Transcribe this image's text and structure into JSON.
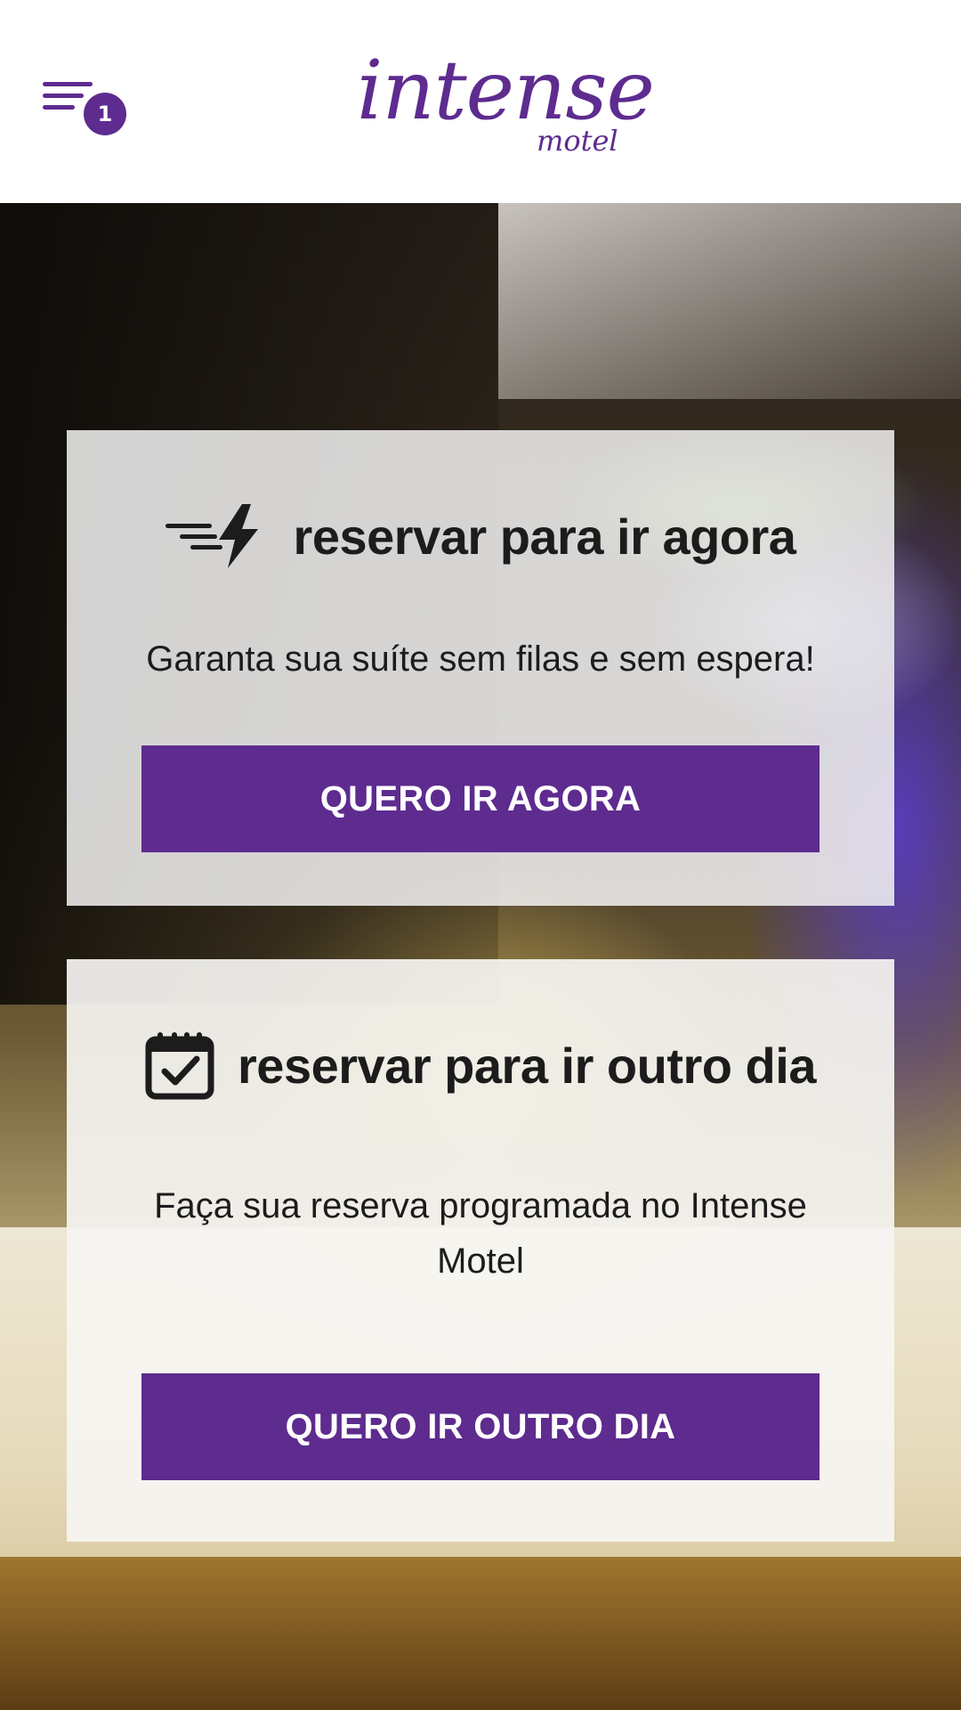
{
  "header": {
    "menu_badge_count": "1",
    "logo_main": "intense",
    "logo_sub": "motel"
  },
  "cards": [
    {
      "title": "reservar para ir agora",
      "description": "Garanta sua suíte sem filas e sem espera!",
      "button_label": "QUERO IR AGORA",
      "icon": "fast-lightning-icon"
    },
    {
      "title": "reservar para ir outro dia",
      "description": "Faça sua reserva programada no Intense Motel",
      "button_label": "QUERO IR OUTRO DIA",
      "icon": "calendar-check-icon"
    }
  ],
  "colors": {
    "brand": "#5e2b8f",
    "text": "#1c1c1c",
    "card_bg": "#f2f2f2"
  }
}
